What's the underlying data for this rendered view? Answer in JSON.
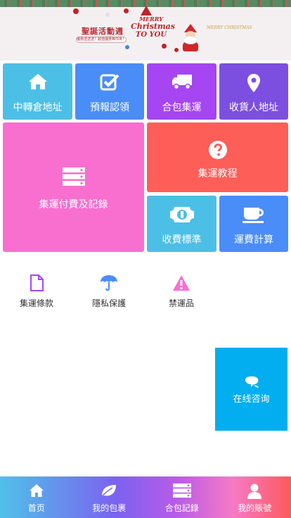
{
  "banner": {
    "event_title": "聖誕活動週",
    "event_sub": "優惠送送送！超值優惠等你來！",
    "merry": "MERRY",
    "christmas": "Christmas",
    "to_you": "TO YOU",
    "gold_text": "MERRY CHRISTMAS"
  },
  "tiles": {
    "transfer_address": "中轉倉地址",
    "prereport_claim": "預報認領",
    "package_consolidate": "合包集運",
    "recipient_address": "收貨人地址",
    "payment_records": "集運付費及記錄",
    "tutorial": "集運教程",
    "fee_standard": "收費標準",
    "shipping_calc": "運費計算"
  },
  "links": {
    "terms": "集運條款",
    "privacy": "隱私保護",
    "prohibited": "禁運品"
  },
  "consult": {
    "label": "在线咨询"
  },
  "nav": {
    "home": "首页",
    "my_packages": "我的包裹",
    "consolidate_records": "合包記錄",
    "my_account": "我的賬號"
  },
  "colors": {
    "cyan": "#4cbfe6",
    "blue": "#4a8df8",
    "purple": "#a546f2",
    "violet": "#7d4fe0",
    "pink": "#f86fd0",
    "red": "#fd5e58",
    "consult": "#02aef0"
  },
  "icons": {
    "transfer_address": "home-icon",
    "prereport_claim": "checkbox-icon",
    "package_consolidate": "truck-icon",
    "recipient_address": "map-pin-icon",
    "payment_records": "server-icon",
    "tutorial": "question-circle-icon",
    "fee_standard": "money-icon",
    "shipping_calc": "coffee-cup-icon",
    "terms": "document-icon",
    "privacy": "umbrella-icon",
    "prohibited": "warning-icon",
    "consult": "chat-bubble-icon"
  }
}
